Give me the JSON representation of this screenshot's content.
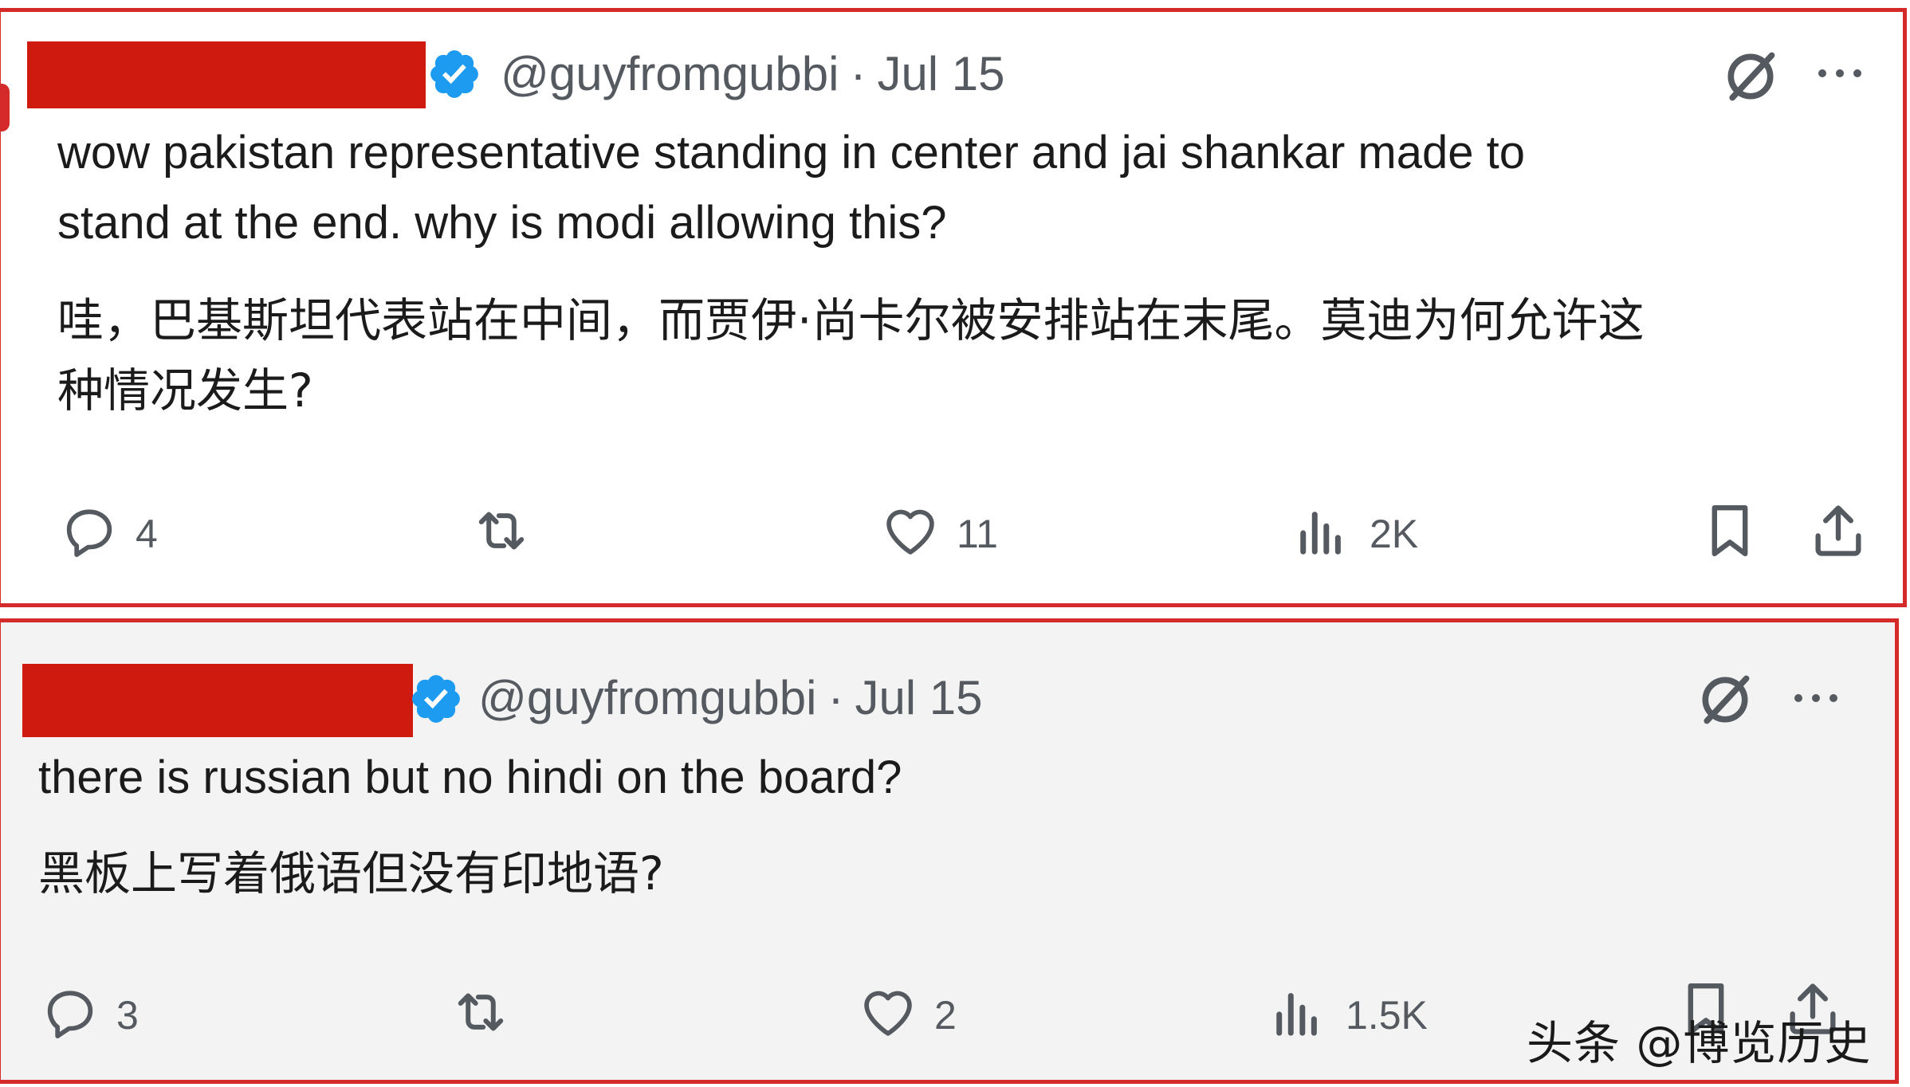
{
  "tweets": [
    {
      "handle": "@guyfromgubbi",
      "separator": "·",
      "date": "Jul 15",
      "text_en_line1": "wow pakistan representative standing in center and jai shankar made to",
      "text_en_line2": "stand at the end. why is modi allowing this?",
      "text_zh_line1": "哇，巴基斯坦代表站在中间，而贾伊·尚卡尔被安排站在末尾。莫迪为何允许这",
      "text_zh_line2": "种情况发生?",
      "replies": "4",
      "likes": "11",
      "views": "2K"
    },
    {
      "handle": "@guyfromgubbi",
      "separator": "·",
      "date": "Jul 15",
      "text_en_line1": "there is russian but no hindi on the board?",
      "text_zh_line1": "黑板上写着俄语但没有印地语?",
      "replies": "3",
      "likes": "2",
      "views": "1.5K"
    }
  ],
  "watermark": "头条 @博览历史",
  "colors": {
    "border": "#d42a2a",
    "redaction": "#cf1a10",
    "verified": "#1d9bf0",
    "icon_gray": "#555a60"
  },
  "icons": [
    "verified-badge-icon",
    "grok-icon",
    "more-icon",
    "reply-icon",
    "retweet-icon",
    "like-icon",
    "views-icon",
    "bookmark-icon",
    "share-icon"
  ]
}
